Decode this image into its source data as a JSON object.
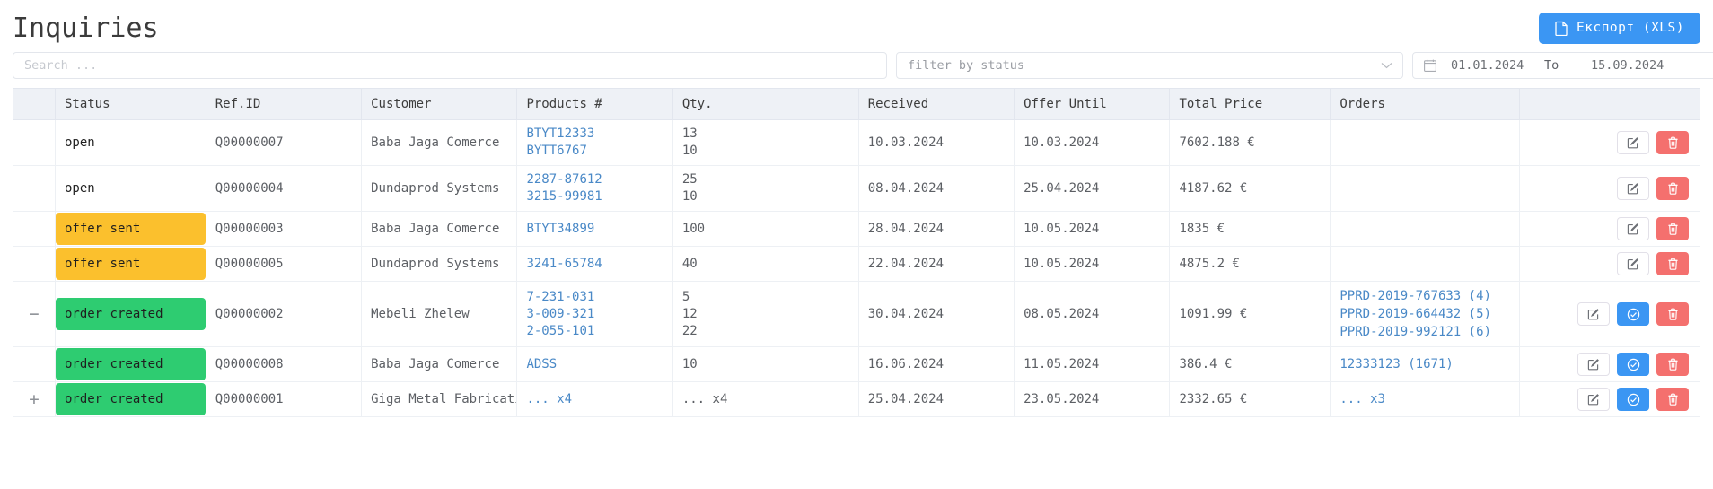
{
  "header": {
    "title": "Inquiries",
    "export_label": "Експорт  (XLS)",
    "export_icon": "document-icon",
    "export_color": "#3b96f3"
  },
  "filters": {
    "search_placeholder": "Search ...",
    "search_value": "",
    "status_placeholder": "filter by status",
    "status_selected": "",
    "chevron_icon": "chevron-down-icon",
    "calendar_icon": "calendar-icon",
    "date_from": "01.01.2024",
    "date_separator": "To",
    "date_to": "15.09.2024"
  },
  "table": {
    "columns": [
      "",
      "Status",
      "Ref.ID",
      "Customer",
      "Products #",
      "Qty.",
      "Received",
      "Offer Until",
      "Total Price",
      "Orders",
      ""
    ],
    "rows": [
      {
        "expander": "",
        "status": "open",
        "status_style": "plain",
        "ref_id": "Q00000007",
        "customer": "Baba Jaga Comerce",
        "products": [
          "BTYT12333",
          "BYTT6767"
        ],
        "qty": [
          "13",
          "10"
        ],
        "received": "10.03.2024",
        "offer_until": "10.03.2024",
        "total_price": "7602.188 €",
        "orders": [],
        "actions": [
          "edit",
          "delete"
        ]
      },
      {
        "expander": "",
        "status": "open",
        "status_style": "plain",
        "ref_id": "Q00000004",
        "customer": "Dundaprod Systems",
        "products": [
          "2287-87612",
          "3215-99981"
        ],
        "qty": [
          "25",
          "10"
        ],
        "received": "08.04.2024",
        "offer_until": "25.04.2024",
        "total_price": "4187.62 €",
        "orders": [],
        "actions": [
          "edit",
          "delete"
        ]
      },
      {
        "expander": "",
        "status": "offer sent",
        "status_style": "yellow",
        "ref_id": "Q00000003",
        "customer": "Baba Jaga Comerce",
        "products": [
          "BTYT34899"
        ],
        "qty": [
          "100"
        ],
        "received": "28.04.2024",
        "offer_until": "10.05.2024",
        "total_price": "1835 €",
        "orders": [],
        "actions": [
          "edit",
          "delete"
        ]
      },
      {
        "expander": "",
        "status": "offer sent",
        "status_style": "yellow",
        "ref_id": "Q00000005",
        "customer": "Dundaprod Systems",
        "products": [
          "3241-65784"
        ],
        "qty": [
          "40"
        ],
        "received": "22.04.2024",
        "offer_until": "10.05.2024",
        "total_price": "4875.2 €",
        "orders": [],
        "actions": [
          "edit",
          "delete"
        ]
      },
      {
        "expander": "−",
        "status": "order created",
        "status_style": "green",
        "ref_id": "Q00000002",
        "customer": "Mebeli Zhelew",
        "products": [
          "7-231-031",
          "3-009-321",
          "2-055-101"
        ],
        "qty": [
          "5",
          "12",
          "22"
        ],
        "received": "30.04.2024",
        "offer_until": "08.05.2024",
        "total_price": "1091.99 €",
        "orders": [
          "PPRD-2019-767633  (4)",
          "PPRD-2019-664432  (5)",
          "PPRD-2019-992121  (6)"
        ],
        "actions": [
          "edit",
          "check",
          "delete"
        ]
      },
      {
        "expander": "",
        "status": "order created",
        "status_style": "green",
        "ref_id": "Q00000008",
        "customer": "Baba Jaga Comerce",
        "products": [
          "ADSS"
        ],
        "qty": [
          "10"
        ],
        "received": "16.06.2024",
        "offer_until": "11.05.2024",
        "total_price": "386.4 €",
        "orders": [
          "12333123  (1671)"
        ],
        "actions": [
          "edit",
          "check",
          "delete"
        ]
      },
      {
        "expander": "+",
        "status": "order created",
        "status_style": "green",
        "ref_id": "Q00000001",
        "customer": "Giga Metal Fabrication",
        "products": [
          "...  x4"
        ],
        "qty": [
          "...  x4"
        ],
        "received": "25.04.2024",
        "offer_until": "23.05.2024",
        "total_price": "2332.65 €",
        "orders": [
          "...  x3"
        ],
        "actions": [
          "edit",
          "check",
          "delete"
        ]
      }
    ]
  },
  "colors": {
    "accent_blue": "#3b96f3",
    "status_yellow": "#fbc02d",
    "status_green": "#2ecc71",
    "danger_red": "#f4706e",
    "link_blue": "#4a89c7",
    "header_bg": "#eef1f6"
  }
}
